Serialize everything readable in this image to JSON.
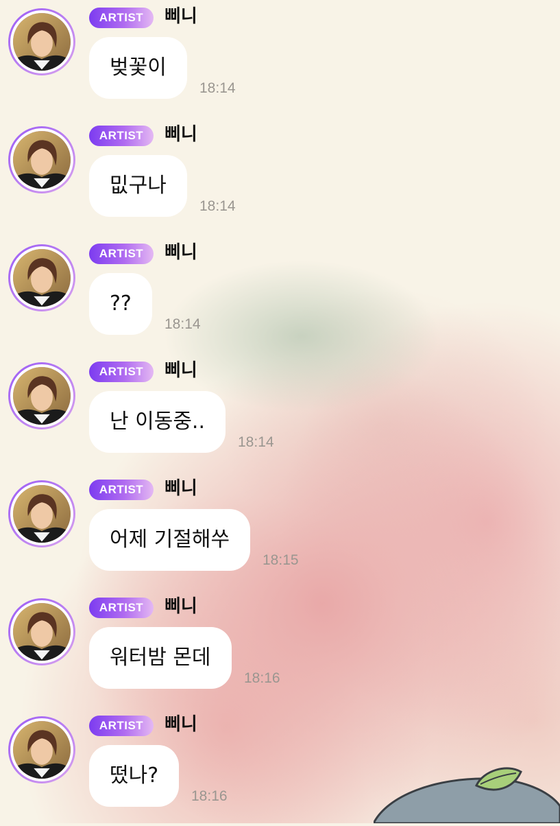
{
  "messages": [
    {
      "badge": "ARTIST",
      "sender": "삐니",
      "text": "벚꽃이",
      "time": "18:14"
    },
    {
      "badge": "ARTIST",
      "sender": "삐니",
      "text": "밊구나",
      "time": "18:14"
    },
    {
      "badge": "ARTIST",
      "sender": "삐니",
      "text": "??",
      "time": "18:14"
    },
    {
      "badge": "ARTIST",
      "sender": "삐니",
      "text": "난 이동중..",
      "time": "18:14"
    },
    {
      "badge": "ARTIST",
      "sender": "삐니",
      "text": "어제 기절해쑤",
      "time": "18:15"
    },
    {
      "badge": "ARTIST",
      "sender": "삐니",
      "text": "워터밤 몬데",
      "time": "18:16"
    },
    {
      "badge": "ARTIST",
      "sender": "삐니",
      "text": "떴나?",
      "time": "18:16"
    }
  ],
  "colors": {
    "background": "#f8f3e7",
    "badge_start": "#7c3cf0",
    "badge_end": "#e4b8f3",
    "bubble": "#ffffff",
    "timestamp": "#9a9690"
  },
  "icons": {
    "avatar": "profile-photo",
    "sticker": "leaf-sticker"
  }
}
